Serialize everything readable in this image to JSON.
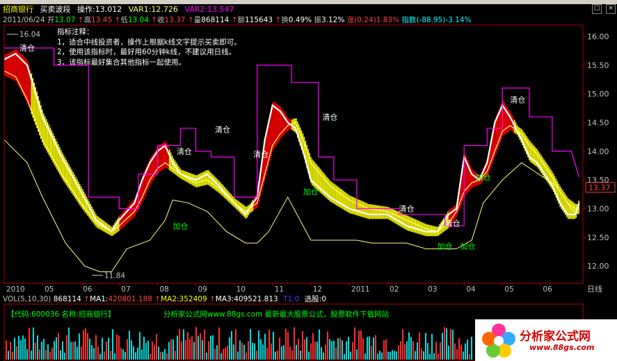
{
  "header": {
    "stock_name": "招商银行",
    "indicator_name": "买卖波段",
    "op_label": "操作:",
    "op_value": "13.012",
    "var1_label": "VAR1:",
    "var1_value": "12.726",
    "var2_label": "VAR2:",
    "var2_value": "13.547",
    "date": "2011/06/24",
    "open_label": "开",
    "open_value": "13.07",
    "high_label": "高",
    "high_value": "13.45",
    "low_label": "低",
    "low_value": "13.04",
    "close_label": "收",
    "close_value": "13.37",
    "vol_label": "量",
    "vol_value": "868114",
    "amount_label": "额",
    "amount_value": "115643",
    "turnover_label": "换",
    "turnover_value": "0.49%",
    "amplitude_label": "振",
    "amplitude_value": "3.12%",
    "change_label": "涨",
    "change_value": "(0.24)1.83%",
    "index_label": "指数",
    "index_value": "(-88.95)-3.14%"
  },
  "notes": {
    "title": "指标注释：",
    "line1": "1，适合中线投资者，操作上根据k线文字提示买卖即可。",
    "line2": "2，使用该指标时，最好用60分钟k线，不建议用日线。",
    "line3": "3，该指标最好集合其他指标一起使用。"
  },
  "colors": {
    "bull_band": "#ff0000",
    "bear_band": "#ffff00",
    "operation_line": "#ffffff",
    "var1_line": "#ffff80",
    "var2_line": "#ff00ff",
    "axis": "#b00000",
    "buy_text": "#00ff00",
    "sell_text": "#ffffff"
  },
  "chart_data": {
    "type": "line",
    "period_label": "日线",
    "ylim": [
      11.7,
      16.2
    ],
    "y_ticks": [
      "16.00",
      "15.50",
      "15.00",
      "14.50",
      "14.00",
      "13.50",
      "13.00",
      "12.50",
      "12.00"
    ],
    "x_ticks": [
      "2010",
      "05",
      "06",
      "07",
      "08",
      "09",
      "10",
      "11",
      "12",
      "2011",
      "02",
      "03",
      "04",
      "05",
      "06"
    ],
    "last_price_label": "13.37",
    "high_marker": "16.04",
    "low_marker": "11.84",
    "annotations": [
      {
        "text": "清仓",
        "kind": "sell",
        "month": 0.4,
        "price": 15.75
      },
      {
        "text": "清仓",
        "kind": "sell",
        "month": 4.5,
        "price": 13.95
      },
      {
        "text": "加仓",
        "kind": "buy",
        "month": 4.4,
        "price": 12.65
      },
      {
        "text": "清仓",
        "kind": "sell",
        "month": 5.5,
        "price": 14.33
      },
      {
        "text": "清仓",
        "kind": "sell",
        "month": 6.5,
        "price": 13.9
      },
      {
        "text": "清仓",
        "kind": "sell",
        "month": 8.3,
        "price": 14.55
      },
      {
        "text": "加仓",
        "kind": "buy",
        "month": 7.8,
        "price": 13.25
      },
      {
        "text": "清仓",
        "kind": "sell",
        "month": 10.3,
        "price": 12.95
      },
      {
        "text": "清仓",
        "kind": "sell",
        "month": 11.5,
        "price": 12.7
      },
      {
        "text": "加仓",
        "kind": "buy",
        "month": 11.3,
        "price": 12.3
      },
      {
        "text": "加仓",
        "kind": "buy",
        "month": 11.9,
        "price": 12.3
      },
      {
        "text": "加仓",
        "kind": "buy",
        "month": 12.3,
        "price": 13.5
      },
      {
        "text": "清仓",
        "kind": "sell",
        "month": 13.2,
        "price": 14.85
      }
    ],
    "series": [
      {
        "name": "操作",
        "values": [
          [
            0.0,
            15.6
          ],
          [
            0.3,
            15.7
          ],
          [
            0.6,
            15.5
          ],
          [
            1.0,
            14.6
          ],
          [
            1.5,
            13.9
          ],
          [
            2.0,
            13.3
          ],
          [
            2.4,
            12.8
          ],
          [
            2.8,
            12.6
          ],
          [
            3.0,
            12.8
          ],
          [
            3.4,
            13.1
          ],
          [
            3.6,
            13.5
          ],
          [
            3.8,
            13.8
          ],
          [
            4.0,
            14.0
          ],
          [
            4.2,
            14.1
          ],
          [
            4.4,
            13.8
          ],
          [
            4.6,
            13.6
          ],
          [
            5.0,
            13.5
          ],
          [
            5.3,
            13.6
          ],
          [
            5.6,
            13.4
          ],
          [
            6.0,
            13.1
          ],
          [
            6.3,
            12.9
          ],
          [
            6.6,
            13.2
          ],
          [
            6.8,
            14.2
          ],
          [
            7.0,
            14.8
          ],
          [
            7.2,
            14.7
          ],
          [
            7.4,
            14.5
          ],
          [
            7.6,
            14.4
          ],
          [
            7.8,
            14.0
          ],
          [
            8.0,
            13.5
          ],
          [
            8.5,
            13.2
          ],
          [
            9.0,
            13.0
          ],
          [
            9.5,
            12.9
          ],
          [
            10.0,
            12.9
          ],
          [
            10.5,
            12.7
          ],
          [
            11.0,
            12.6
          ],
          [
            11.3,
            12.6
          ],
          [
            11.6,
            12.9
          ],
          [
            11.8,
            13.0
          ],
          [
            12.0,
            13.9
          ],
          [
            12.2,
            13.6
          ],
          [
            12.4,
            13.5
          ],
          [
            12.6,
            13.8
          ],
          [
            12.8,
            14.5
          ],
          [
            13.0,
            14.8
          ],
          [
            13.2,
            14.6
          ],
          [
            13.5,
            14.2
          ],
          [
            13.7,
            13.9
          ],
          [
            13.9,
            13.8
          ],
          [
            14.1,
            13.6
          ],
          [
            14.3,
            13.4
          ],
          [
            14.5,
            13.1
          ],
          [
            14.7,
            12.9
          ],
          [
            14.9,
            12.9
          ],
          [
            15.0,
            13.1
          ]
        ]
      },
      {
        "name": "VAR1",
        "values": [
          [
            0.0,
            15.4
          ],
          [
            0.3,
            15.3
          ],
          [
            0.6,
            14.9
          ],
          [
            1.0,
            14.2
          ],
          [
            1.5,
            13.6
          ],
          [
            2.0,
            13.1
          ],
          [
            2.4,
            12.75
          ],
          [
            2.8,
            12.6
          ],
          [
            3.0,
            12.7
          ],
          [
            3.4,
            12.95
          ],
          [
            3.6,
            13.2
          ],
          [
            3.8,
            13.5
          ],
          [
            4.0,
            13.7
          ],
          [
            4.2,
            13.8
          ],
          [
            4.4,
            13.7
          ],
          [
            4.6,
            13.6
          ],
          [
            5.0,
            13.45
          ],
          [
            5.3,
            13.5
          ],
          [
            5.6,
            13.35
          ],
          [
            6.0,
            13.1
          ],
          [
            6.3,
            12.95
          ],
          [
            6.6,
            13.1
          ],
          [
            6.8,
            13.6
          ],
          [
            7.0,
            14.1
          ],
          [
            7.2,
            14.3
          ],
          [
            7.4,
            14.45
          ],
          [
            7.6,
            14.5
          ],
          [
            7.8,
            14.2
          ],
          [
            8.0,
            13.8
          ],
          [
            8.5,
            13.4
          ],
          [
            9.0,
            13.15
          ],
          [
            9.5,
            13.0
          ],
          [
            10.0,
            12.95
          ],
          [
            10.5,
            12.8
          ],
          [
            11.0,
            12.65
          ],
          [
            11.3,
            12.6
          ],
          [
            11.6,
            12.75
          ],
          [
            11.8,
            12.95
          ],
          [
            12.0,
            13.3
          ],
          [
            12.2,
            13.45
          ],
          [
            12.4,
            13.5
          ],
          [
            12.6,
            13.65
          ],
          [
            12.8,
            14.0
          ],
          [
            13.0,
            14.35
          ],
          [
            13.2,
            14.45
          ],
          [
            13.5,
            14.3
          ],
          [
            13.7,
            14.1
          ],
          [
            13.9,
            13.95
          ],
          [
            14.1,
            13.75
          ],
          [
            14.3,
            13.55
          ],
          [
            14.5,
            13.3
          ],
          [
            14.7,
            13.1
          ],
          [
            14.9,
            13.0
          ],
          [
            15.0,
            13.0
          ]
        ]
      },
      {
        "name": "VAR2",
        "values": [
          [
            0.0,
            15.8
          ],
          [
            0.5,
            15.8
          ],
          [
            1.3,
            15.8
          ],
          [
            1.3,
            15.5
          ],
          [
            2.2,
            15.5
          ],
          [
            2.2,
            13.2
          ],
          [
            3.0,
            13.2
          ],
          [
            3.0,
            13.0
          ],
          [
            3.5,
            13.0
          ],
          [
            3.5,
            13.6
          ],
          [
            4.0,
            13.6
          ],
          [
            4.0,
            14.1
          ],
          [
            4.6,
            14.1
          ],
          [
            4.6,
            14.4
          ],
          [
            5.0,
            14.4
          ],
          [
            5.0,
            14.0
          ],
          [
            5.4,
            14.0
          ],
          [
            5.4,
            13.9
          ],
          [
            6.0,
            13.9
          ],
          [
            6.0,
            13.2
          ],
          [
            6.6,
            13.2
          ],
          [
            6.6,
            15.5
          ],
          [
            7.5,
            15.5
          ],
          [
            7.5,
            15.2
          ],
          [
            8.2,
            15.2
          ],
          [
            8.2,
            13.9
          ],
          [
            8.6,
            13.9
          ],
          [
            8.6,
            13.5
          ],
          [
            9.2,
            13.5
          ],
          [
            9.2,
            13.0
          ],
          [
            10.3,
            13.0
          ],
          [
            10.3,
            12.9
          ],
          [
            11.5,
            12.9
          ],
          [
            11.5,
            12.7
          ],
          [
            12.0,
            12.7
          ],
          [
            12.0,
            14.1
          ],
          [
            12.6,
            14.1
          ],
          [
            12.6,
            14.4
          ],
          [
            13.0,
            14.4
          ],
          [
            13.0,
            15.1
          ],
          [
            13.7,
            15.1
          ],
          [
            13.7,
            14.6
          ],
          [
            14.3,
            14.6
          ],
          [
            14.3,
            14.0
          ],
          [
            14.8,
            14.0
          ],
          [
            15.0,
            13.55
          ]
        ]
      },
      {
        "name": "support",
        "values": [
          [
            0.0,
            14.2
          ],
          [
            0.6,
            13.8
          ],
          [
            1.0,
            13.2
          ],
          [
            1.6,
            12.4
          ],
          [
            2.1,
            12.0
          ],
          [
            2.5,
            11.9
          ],
          [
            2.8,
            11.9
          ],
          [
            3.2,
            12.3
          ],
          [
            3.8,
            12.45
          ],
          [
            4.2,
            12.8
          ],
          [
            4.4,
            13.15
          ],
          [
            4.8,
            13.1
          ],
          [
            5.3,
            12.95
          ],
          [
            5.8,
            12.6
          ],
          [
            6.3,
            12.4
          ],
          [
            6.6,
            12.4
          ],
          [
            6.9,
            12.6
          ],
          [
            7.4,
            13.2
          ],
          [
            8.0,
            12.45
          ],
          [
            9.2,
            12.45
          ],
          [
            9.6,
            12.4
          ],
          [
            10.5,
            12.4
          ],
          [
            11.0,
            12.3
          ],
          [
            11.8,
            12.3
          ],
          [
            12.2,
            12.45
          ],
          [
            12.5,
            13.1
          ],
          [
            13.0,
            13.5
          ],
          [
            13.5,
            13.8
          ],
          [
            14.4,
            13.4
          ],
          [
            14.8,
            13.0
          ],
          [
            15.0,
            12.9
          ]
        ]
      }
    ],
    "band_bars": [
      {
        "from": 0.0,
        "to": 0.7,
        "kind": "bull"
      },
      {
        "from": 0.7,
        "to": 3.0,
        "kind": "bear"
      },
      {
        "from": 3.0,
        "to": 4.3,
        "kind": "bull"
      },
      {
        "from": 4.3,
        "to": 6.5,
        "kind": "bear"
      },
      {
        "from": 6.5,
        "to": 7.5,
        "kind": "bull"
      },
      {
        "from": 7.5,
        "to": 11.6,
        "kind": "bear"
      },
      {
        "from": 11.6,
        "to": 13.3,
        "kind": "bull"
      },
      {
        "from": 13.3,
        "to": 15.0,
        "kind": "bear"
      }
    ]
  },
  "volume": {
    "label": "VOL(5,10,30)",
    "vol_value": "868114",
    "ma1_label": "MA1:",
    "ma1_value": "420801.188",
    "ma2_label": "MA2:",
    "ma2_value": "352409",
    "ma3_label": "MA3:",
    "ma3_value": "409521.813",
    "t1_label": "T1:",
    "t1_value": "0",
    "select_label": "选股:",
    "select_value": "0"
  },
  "footer": {
    "code_label": "【代码:",
    "code_value": "600036",
    "name_label": "名称:",
    "name_value": "招商银行】",
    "promo": "分析家公式网www.88gs.com  最新最大股票公式，股票软件下载网站",
    "logo_title": "分析家公式网",
    "logo_url": "www.88gs.com"
  }
}
